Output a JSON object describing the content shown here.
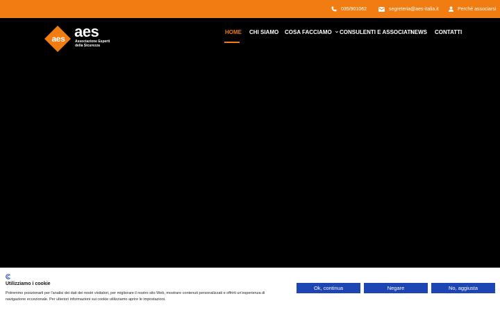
{
  "colors": {
    "accent": "#f07c12",
    "button": "#1d45b4"
  },
  "topbar": {
    "phone": "035/901062",
    "phone_icon": "phone-icon",
    "email": "segreteria@aes-italia.it",
    "email_icon": "envelope-icon",
    "join": "Perché associarsi",
    "join_icon": "user-icon"
  },
  "logo": {
    "mark_text": "aes",
    "brand": "aes",
    "tagline_line1": "Associazione Esperti",
    "tagline_line2": "della Sicurezza"
  },
  "nav": {
    "items": [
      {
        "label": "HOME",
        "active": true
      },
      {
        "label": "CHI SIAMO"
      },
      {
        "label": "COSA FACCIAMO",
        "has_dropdown": true
      },
      {
        "label": "CONSULENTI E ASSOCIATI"
      },
      {
        "label": "NEWS"
      },
      {
        "label": "CONTATTI"
      }
    ]
  },
  "cookie": {
    "title": "Utilizziamo i cookie",
    "text": "Potremmo posizionarli per l'analisi dei dati dei nostri visitatori, per migliorare il nostro sito Web, mostrare contenuti personalizzati e offrirti un'esperienza di navigazione eccezionale. Per ulteriori informazioni sui cookie utilizziamo aprire le impostazioni.",
    "accept": "Ok, continua",
    "deny": "Negare",
    "refresh": "No, aggiusta"
  }
}
